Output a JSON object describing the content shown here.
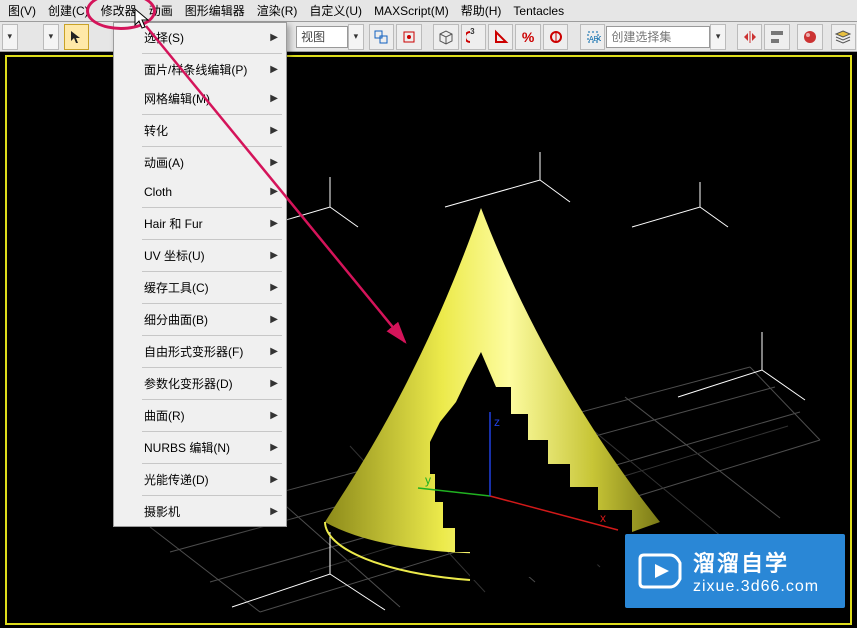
{
  "menubar": {
    "items": [
      "图(V)",
      "创建(C)",
      "修改器",
      "动画",
      "图形编辑器",
      "渲染(R)",
      "自定义(U)",
      "MAXScript(M)",
      "帮助(H)",
      "Tentacles"
    ]
  },
  "toolbar": {
    "view_label": "视图",
    "selset_placeholder": "创建选择集"
  },
  "dropdown": {
    "items": [
      {
        "label": "选择(S)",
        "sub": true,
        "sep": true
      },
      {
        "label": "面片/样条线编辑(P)",
        "sub": true
      },
      {
        "label": "网格编辑(M)",
        "sub": true,
        "sep": true
      },
      {
        "label": "转化",
        "sub": true,
        "sep": true
      },
      {
        "label": "动画(A)",
        "sub": true
      },
      {
        "label": "Cloth",
        "sub": true,
        "sep": true
      },
      {
        "label": "Hair 和 Fur",
        "sub": true,
        "sep": true
      },
      {
        "label": "UV 坐标(U)",
        "sub": true,
        "sep": true
      },
      {
        "label": "缓存工具(C)",
        "sub": true,
        "sep": true
      },
      {
        "label": "细分曲面(B)",
        "sub": true,
        "sep": true
      },
      {
        "label": "自由形式变形器(F)",
        "sub": true,
        "sep": true
      },
      {
        "label": "参数化变形器(D)",
        "sub": true,
        "sep": true
      },
      {
        "label": "曲面(R)",
        "sub": true,
        "sep": true
      },
      {
        "label": "NURBS 编辑(N)",
        "sub": true,
        "sep": true
      },
      {
        "label": "光能传递(D)",
        "sub": true,
        "sep": true
      },
      {
        "label": "摄影机",
        "sub": true
      }
    ]
  },
  "watermark": {
    "title": "溜溜自学",
    "url": "zixue.3d66.com"
  },
  "viewport": {
    "axis_x": "x",
    "axis_y": "y",
    "axis_z": "z"
  }
}
